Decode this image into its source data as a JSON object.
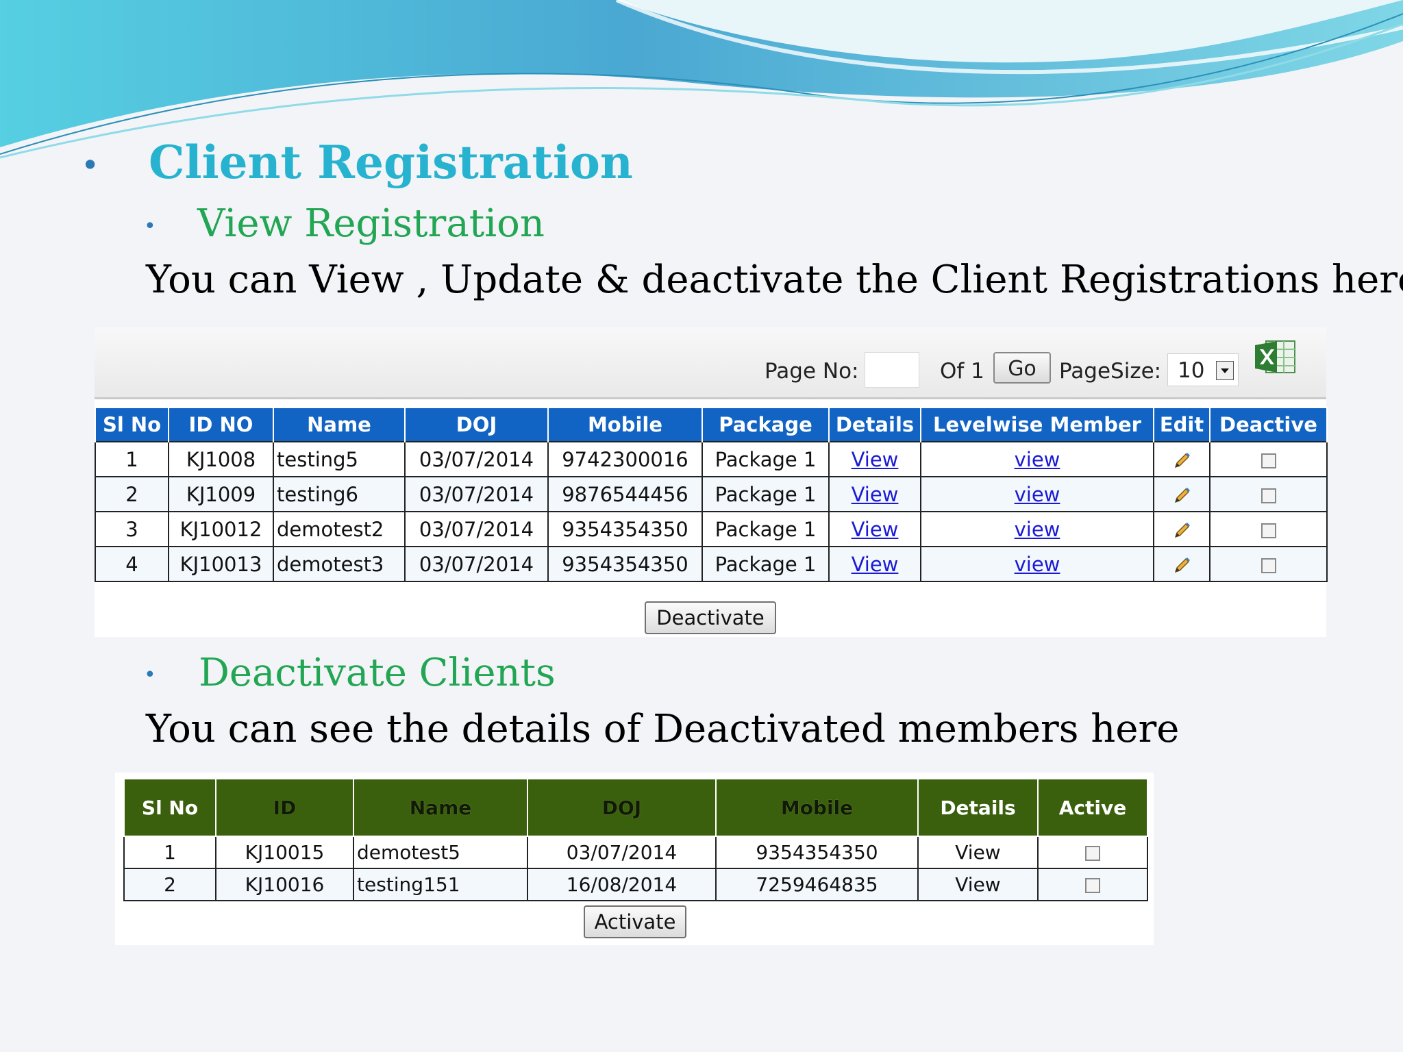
{
  "slide": {
    "title": "Client Registration",
    "section1_heading": "View Registration",
    "section1_desc": "You can View , Update & deactivate the Client Registrations here",
    "section2_heading": "Deactivate Clients",
    "section2_desc": "You can see the details of Deactivated members here",
    "bullet_major": "•",
    "bullet_minor": "•"
  },
  "pager": {
    "page_no_label": "Page No:",
    "page_no_value": "",
    "of_label": "Of 1",
    "go_label": "Go",
    "pagesize_label": "PageSize:",
    "pagesize_value": "10",
    "export_icon": "excel-icon"
  },
  "registrations": {
    "headers": [
      "Sl No",
      "ID NO",
      "Name",
      "DOJ",
      "Mobile",
      "Package",
      "Details",
      "Levelwise Member",
      "Edit",
      "Deactive"
    ],
    "rows": [
      {
        "sl": "1",
        "id": "KJ1008",
        "name": "testing5",
        "doj": "03/07/2014",
        "mobile": "9742300016",
        "package": "Package 1",
        "details": "View",
        "levelwise": "view"
      },
      {
        "sl": "2",
        "id": "KJ1009",
        "name": "testing6",
        "doj": "03/07/2014",
        "mobile": "9876544456",
        "package": "Package 1",
        "details": "View",
        "levelwise": "view"
      },
      {
        "sl": "3",
        "id": "KJ10012",
        "name": "demotest2",
        "doj": "03/07/2014",
        "mobile": "9354354350",
        "package": "Package 1",
        "details": "View",
        "levelwise": "view"
      },
      {
        "sl": "4",
        "id": "KJ10013",
        "name": "demotest3",
        "doj": "03/07/2014",
        "mobile": "9354354350",
        "package": "Package 1",
        "details": "View",
        "levelwise": "view"
      }
    ],
    "action_label": "Deactivate",
    "header_color": "#1264c4"
  },
  "deactivated": {
    "headers": [
      "Sl No",
      "ID",
      "Name",
      "DOJ",
      "Mobile",
      "Details",
      "Active"
    ],
    "rows": [
      {
        "sl": "1",
        "id": "KJ10015",
        "name": "demotest5",
        "doj": "03/07/2014",
        "mobile": "9354354350",
        "details": "View"
      },
      {
        "sl": "2",
        "id": "KJ10016",
        "name": "testing151",
        "doj": "16/08/2014",
        "mobile": "7259464835",
        "details": "View"
      }
    ],
    "action_label": "Activate",
    "header_color": "#3a600d"
  }
}
